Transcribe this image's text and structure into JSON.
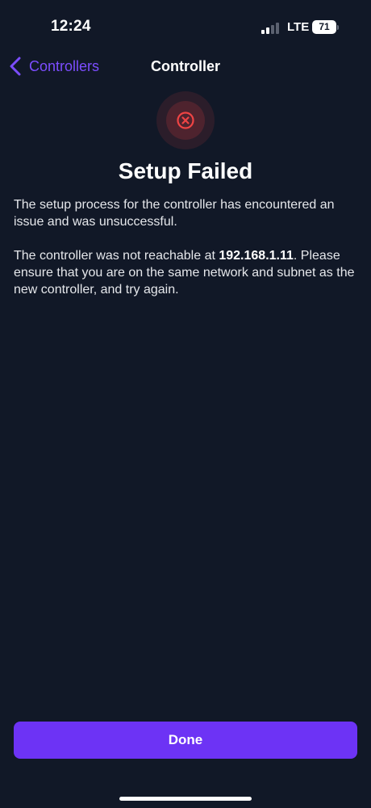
{
  "status_bar": {
    "time": "12:24",
    "network": "LTE",
    "battery": "71",
    "signal_bars_active": 2,
    "signal_bars_total": 4
  },
  "nav": {
    "back_label": "Controllers",
    "title": "Controller",
    "icon": "chevron-left-icon"
  },
  "error": {
    "icon": "error-x-icon",
    "color": "#ef4444"
  },
  "content": {
    "headline": "Setup Failed",
    "paragraph1": "The setup process for the controller has encountered an issue and was unsuccessful.",
    "paragraph2_before": "The controller was not reachable at ",
    "ip_address": "192.168.1.11",
    "paragraph2_after": ". Please ensure that you are on the same network and subnet as the new controller, and try again."
  },
  "actions": {
    "done_label": "Done"
  },
  "colors": {
    "background": "#111827",
    "accent": "#7c4dff",
    "button": "#6d33f5"
  }
}
